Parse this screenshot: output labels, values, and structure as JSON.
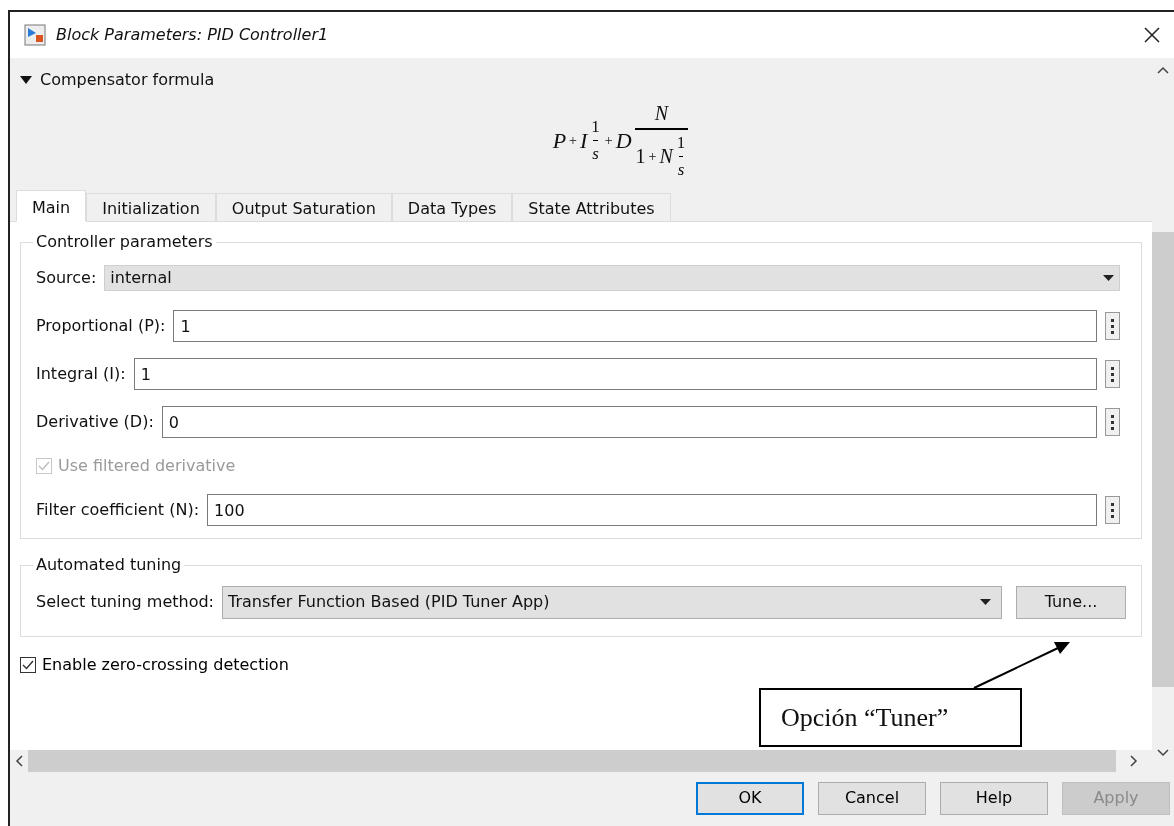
{
  "window": {
    "title": "Block Parameters: PID Controller1"
  },
  "compensator": {
    "label": "Compensator formula",
    "expanded": true,
    "formula": [
      {
        "kind": "sym",
        "text": "P"
      },
      {
        "kind": "op",
        "text": "+"
      },
      {
        "kind": "sym",
        "text": "I"
      },
      {
        "kind": "frac",
        "num": [
          {
            "kind": "num",
            "text": "1"
          }
        ],
        "den": [
          {
            "kind": "sym",
            "text": "s"
          }
        ]
      },
      {
        "kind": "op",
        "text": "+"
      },
      {
        "kind": "sym",
        "text": "D"
      },
      {
        "kind": "frac",
        "big": true,
        "num": [
          {
            "kind": "sym",
            "text": "N"
          }
        ],
        "den": [
          {
            "kind": "num",
            "text": "1"
          },
          {
            "kind": "op",
            "text": "+"
          },
          {
            "kind": "sym",
            "text": "N"
          },
          {
            "kind": "frac",
            "num": [
              {
                "kind": "num",
                "text": "1"
              }
            ],
            "den": [
              {
                "kind": "sym",
                "text": "s"
              }
            ]
          }
        ]
      }
    ]
  },
  "tabs": [
    {
      "label": "Main",
      "selected": true
    },
    {
      "label": "Initialization",
      "selected": false
    },
    {
      "label": "Output Saturation",
      "selected": false
    },
    {
      "label": "Data Types",
      "selected": false
    },
    {
      "label": "State Attributes",
      "selected": false
    }
  ],
  "controller_parameters": {
    "title": "Controller parameters",
    "rows": [
      {
        "kind": "dropdown",
        "label": "Source:",
        "value": "internal"
      },
      {
        "kind": "field",
        "label": "Proportional (P):",
        "value": "1"
      },
      {
        "kind": "field",
        "label": "Integral (I):",
        "value": "1"
      },
      {
        "kind": "field",
        "label": "Derivative (D):",
        "value": "0"
      },
      {
        "kind": "checkbox",
        "label": "Use filtered derivative",
        "checked": true,
        "disabled": true
      },
      {
        "kind": "field",
        "label": "Filter coefficient (N):",
        "value": "100"
      }
    ]
  },
  "automated_tuning": {
    "title": "Automated tuning",
    "label": "Select tuning method:",
    "value": "Transfer Function Based (PID Tuner App)",
    "button": "Tune..."
  },
  "zero_crossing": {
    "label": "Enable zero-crossing detection",
    "checked": true,
    "disabled": false
  },
  "annotation": {
    "text": "Opción “Tuner”"
  },
  "buttons": [
    {
      "label": "OK",
      "kind": "default"
    },
    {
      "label": "Cancel",
      "kind": "normal"
    },
    {
      "label": "Help",
      "kind": "normal"
    },
    {
      "label": "Apply",
      "kind": "disabled"
    }
  ]
}
